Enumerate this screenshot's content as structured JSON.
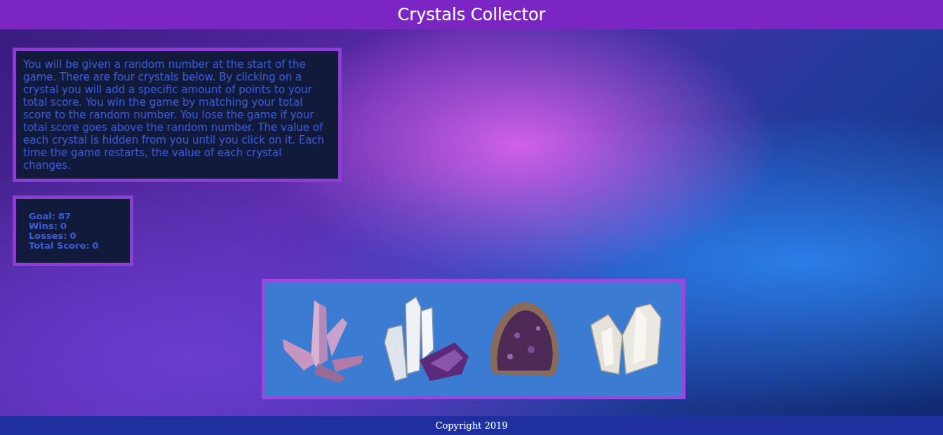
{
  "header": {
    "title": "Crystals Collector"
  },
  "instructions": "You will be given a random number at the start of the game. There are four crystals below. By clicking on a crystal you will add a specific amount of points to your total score. You win the game by matching your total score to the random number. You lose the game if your total score goes above the random number. The value of each crystal is hidden from you until you click on it. Each time the game restarts, the value of each crystal changes.",
  "stats": [
    {
      "label": "Goal:",
      "value": "87"
    },
    {
      "label": "Wins:",
      "value": "0"
    },
    {
      "label": "Losses:",
      "value": "0"
    },
    {
      "label": "Total Score:",
      "value": "0"
    }
  ],
  "crystals": [
    {
      "kind": "pink-cluster"
    },
    {
      "kind": "quartz-amethyst"
    },
    {
      "kind": "geode"
    },
    {
      "kind": "clear-quartz"
    }
  ],
  "footer": {
    "text": "Copyright 2019"
  }
}
